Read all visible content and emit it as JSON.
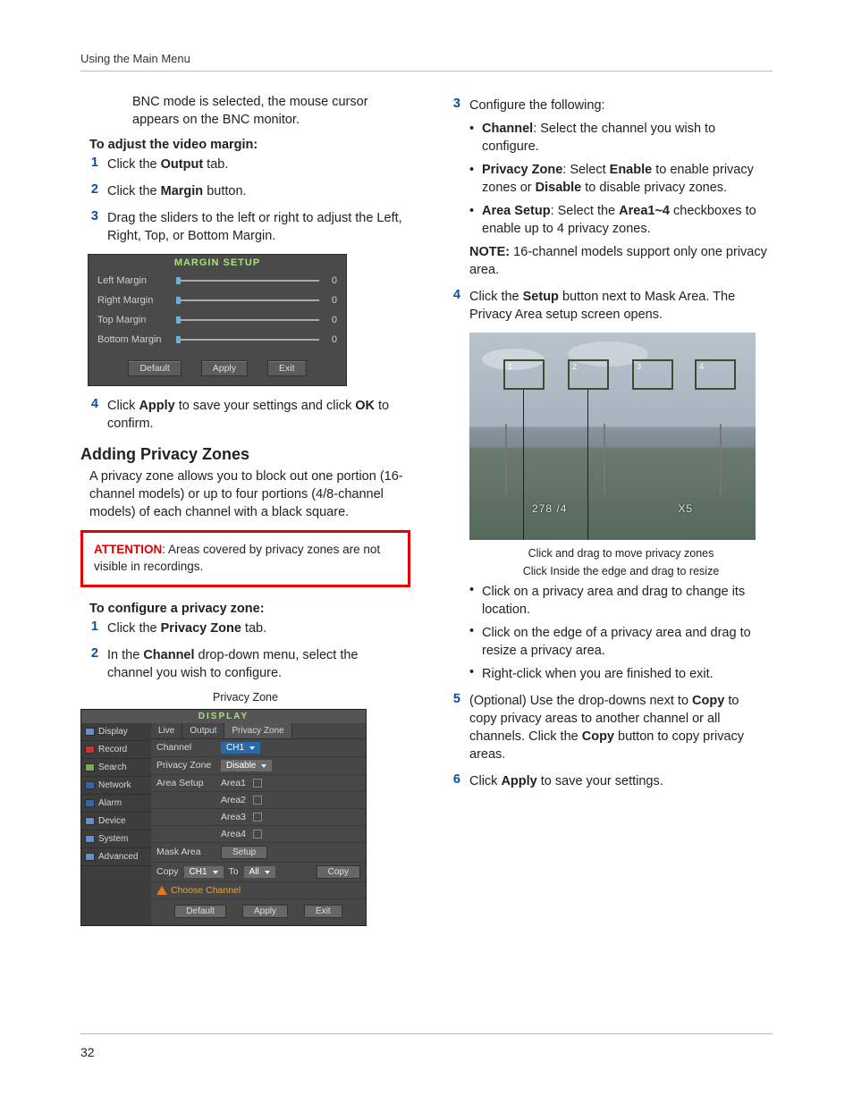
{
  "header": {
    "section": "Using the Main Menu"
  },
  "pageNumber": "32",
  "left": {
    "introFrag": "BNC mode is selected, the mouse cursor appears on the BNC monitor.",
    "adjustHead": "To adjust the video margin:",
    "s1a": "Click the ",
    "s1b": "Output",
    "s1c": " tab.",
    "s2a": "Click the ",
    "s2b": "Margin",
    "s2c": " button.",
    "s3": "Drag the sliders to the left or right to adjust the Left, Right, Top, or Bottom Margin.",
    "s4a": "Click ",
    "s4b": "Apply",
    "s4c": " to save your settings and click ",
    "s4d": "OK",
    "s4e": " to confirm.",
    "privacyH2": "Adding Privacy Zones",
    "privacyIntro": "A privacy zone allows you to block out one portion (16-channel models) or up to four portions (4/8-channel models) of each channel with a black square.",
    "attLabel": "ATTENTION",
    "attText": ": Areas covered by privacy zones are not visible in recordings.",
    "confHead": "To configure a privacy zone:",
    "c1a": "Click the ",
    "c1b": "Privacy Zone",
    "c1c": " tab.",
    "c2a": "In the ",
    "c2b": "Channel",
    "c2c": " drop-down menu, select the channel you wish to configure.",
    "pzCaption": "Privacy Zone"
  },
  "marginSetup": {
    "title": "MARGIN SETUP",
    "rows": [
      {
        "label": "Left Margin",
        "val": "0"
      },
      {
        "label": "Right Margin",
        "val": "0"
      },
      {
        "label": "Top Margin",
        "val": "0"
      },
      {
        "label": "Bottom Margin",
        "val": "0"
      }
    ],
    "btns": {
      "default": "Default",
      "apply": "Apply",
      "exit": "Exit"
    }
  },
  "dispPanel": {
    "title": "DISPLAY",
    "side": [
      "Display",
      "Record",
      "Search",
      "Network",
      "Alarm",
      "Device",
      "System",
      "Advanced"
    ],
    "tabs": [
      "Live",
      "Output",
      "Privacy Zone"
    ],
    "channelLab": "Channel",
    "channelVal": "CH1",
    "pzLab": "Privacy Zone",
    "pzVal": "Disable",
    "areaLab": "Area Setup",
    "areas": [
      "Area1",
      "Area2",
      "Area3",
      "Area4"
    ],
    "maskLab": "Mask Area",
    "setup": "Setup",
    "copyLab": "Copy",
    "copyFrom": "CH1",
    "to": "To",
    "all": "All",
    "copyBtn": "Copy",
    "choose": "Choose Channel",
    "btns": {
      "default": "Default",
      "apply": "Apply",
      "exit": "Exit"
    }
  },
  "right": {
    "s3lead": "Configure the following:",
    "b1a": "Channel",
    "b1b": ": Select the channel you wish to configure.",
    "b2a": "Privacy Zone",
    "b2b": ": Select ",
    "b2c": "Enable",
    "b2d": " to enable privacy zones or ",
    "b2e": "Disable",
    "b2f": " to disable privacy zones.",
    "b3a": "Area Setup",
    "b3b": ": Select the ",
    "b3c": "Area1~4",
    "b3d": " checkboxes to enable up to 4 privacy zones.",
    "noteLab": "NOTE:",
    "noteTxt": " 16-channel models support only one privacy area.",
    "s4a": "Click the ",
    "s4b": "Setup",
    "s4c": " button next to Mask Area. The Privacy Area setup screen opens.",
    "cap1": "Click and drag to move privacy zones",
    "cap2": "Click Inside the edge and drag to resize",
    "bl1": "Click on a privacy area and drag to change its location.",
    "bl2": "Click on the edge of a privacy area and drag to resize a privacy area.",
    "bl3": "Right-click when you are finished to exit.",
    "s5a": "(Optional) Use the drop-downs next to ",
    "s5b": "Copy",
    "s5c": " to copy privacy areas to another channel or all channels. Click the ",
    "s5d": "Copy",
    "s5e": " button to copy privacy areas.",
    "s6a": "Click ",
    "s6b": "Apply",
    "s6c": " to save your settings.",
    "osd1": "278 /4",
    "osd2": "X5",
    "pnum": [
      "1",
      "2",
      "3",
      "4"
    ]
  },
  "nums": {
    "n1": "1",
    "n2": "2",
    "n3": "3",
    "n4": "4",
    "n5": "5",
    "n6": "6"
  }
}
